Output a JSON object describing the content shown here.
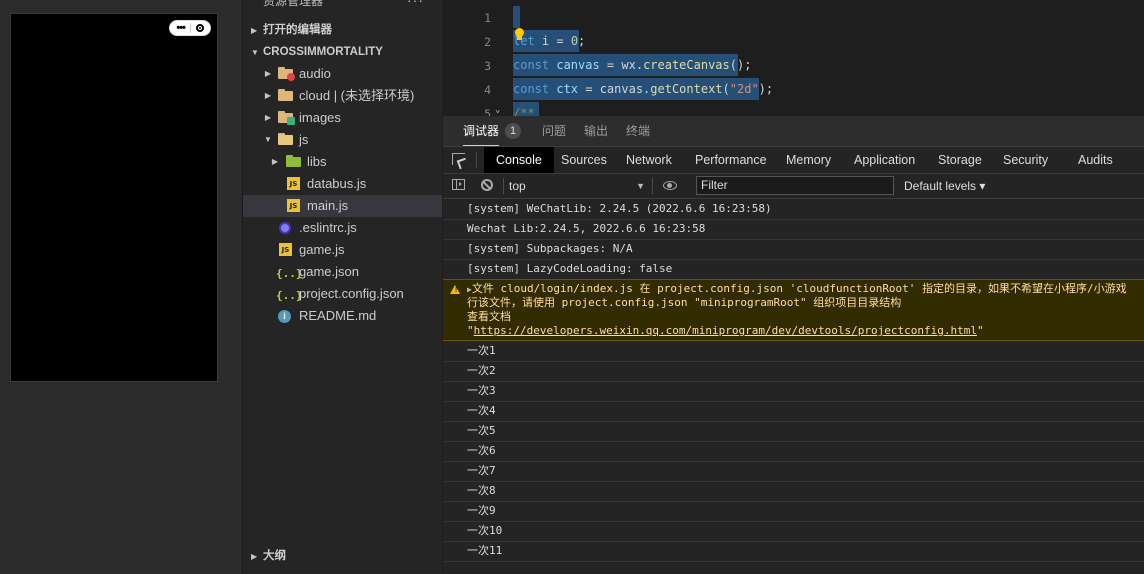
{
  "simulator": {
    "capsule": {
      "more_icon": "more-dots-icon",
      "close_icon": "target-close-icon"
    }
  },
  "explorer": {
    "header": "资源管理器",
    "more": "···",
    "open_editors": "打开的编辑器",
    "project": "CROSSIMMORTALITY",
    "tree": [
      {
        "name": "audio",
        "icon": "folder-audio-icon",
        "caret": "▶"
      },
      {
        "name": "cloud | (未选择环境)",
        "icon": "folder-cloud-icon",
        "caret": "▶"
      },
      {
        "name": "images",
        "icon": "folder-images-icon",
        "caret": "▶"
      },
      {
        "name": "js",
        "icon": "folder-open-icon",
        "caret": "▼"
      },
      {
        "name": "libs",
        "icon": "folder-libs-icon",
        "caret": "▶"
      },
      {
        "name": "databus.js",
        "icon": "js-file-icon",
        "badge": "JS"
      },
      {
        "name": "main.js",
        "icon": "js-file-icon",
        "badge": "JS"
      },
      {
        "name": ".eslintrc.js",
        "icon": "eslint-icon"
      },
      {
        "name": "game.js",
        "icon": "js-file-icon",
        "badge": "JS"
      },
      {
        "name": "game.json",
        "icon": "json-file-icon",
        "badge": "{..}"
      },
      {
        "name": "project.config.json",
        "icon": "json-file-icon",
        "badge": "{..}"
      },
      {
        "name": "README.md",
        "icon": "info-icon",
        "badge": "i"
      }
    ],
    "outline": "大纲"
  },
  "editor": {
    "lines": [
      {
        "n": "1",
        "text": ""
      },
      {
        "n": "2",
        "kw": "let",
        "rest_a": " i = ",
        "num": "0",
        "rest_b": ";"
      },
      {
        "n": "3",
        "kw": "const",
        "var": " canvas",
        "rest_a": " = wx.",
        "fn": "createCanvas",
        "rest_b": "();"
      },
      {
        "n": "4",
        "kw": "const",
        "var": " ctx",
        "rest_a": " = canvas.",
        "fn": "getContext",
        "rest_b": "(",
        "str": "\"2d\"",
        "rest_c": ");"
      },
      {
        "n": "5",
        "cmt": "/**"
      }
    ]
  },
  "devtools": {
    "tabs": [
      "调试器",
      "问题",
      "输出",
      "终端"
    ],
    "debugger_count": "1",
    "panels": [
      "Console",
      "Sources",
      "Network",
      "Performance",
      "Memory",
      "Application",
      "Storage",
      "Security",
      "Audits"
    ],
    "context": "top",
    "filter_placeholder": "Filter",
    "levels": "Default levels ▾",
    "messages": [
      "[system] WeChatLib: 2.24.5 (2022.6.6 16:23:58)",
      "Wechat Lib:2.24.5, 2022.6.6 16:23:58",
      "[system] Subpackages: N/A",
      "[system] LazyCodeLoading: false"
    ],
    "warning": {
      "line1": "文件 cloud/login/index.js 在 project.config.json 'cloudfunctionRoot' 指定的目录，如果不希望在小程序/小游戏",
      "line2": "行该文件，请使用 project.config.json \"miniprogramRoot\" 组织项目目录结构",
      "line3": "查看文档",
      "link": "https://developers.weixin.qq.com/miniprogram/dev/devtools/projectconfig.html"
    },
    "logs": [
      "一次1",
      "一次2",
      "一次3",
      "一次4",
      "一次5",
      "一次6",
      "一次7",
      "一次8",
      "一次9",
      "一次10",
      "一次11"
    ]
  }
}
